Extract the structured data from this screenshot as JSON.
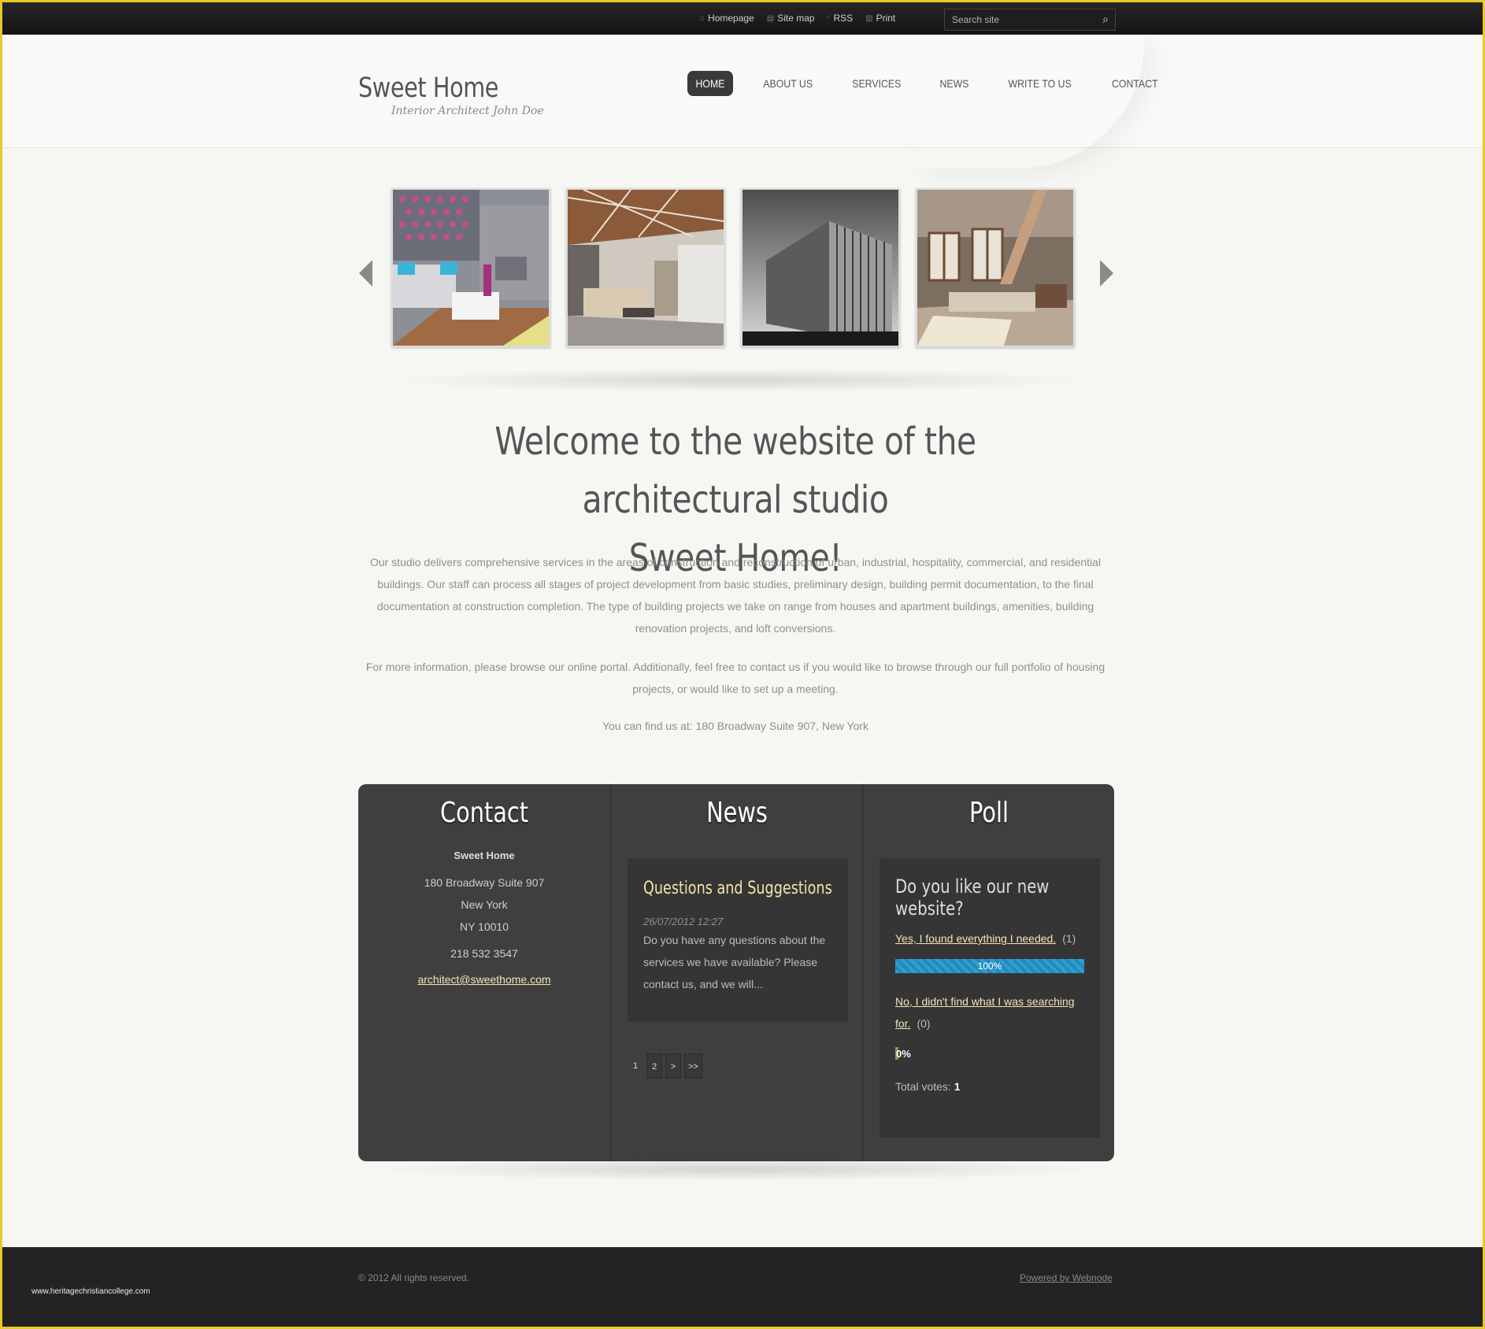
{
  "topbar": {
    "links": [
      {
        "label": "Homepage",
        "icon": "home-icon"
      },
      {
        "label": "Site map",
        "icon": "sitemap-icon"
      },
      {
        "label": "RSS",
        "icon": "rss-icon"
      },
      {
        "label": "Print",
        "icon": "print-icon"
      }
    ],
    "search_placeholder": "Search site"
  },
  "header": {
    "logo": "Sweet Home",
    "tagline": "Interior Architect John Doe",
    "nav": [
      "HOME",
      "ABOUT US",
      "SERVICES",
      "NEWS",
      "WRITE TO US",
      "CONTACT"
    ],
    "active_nav": "HOME"
  },
  "gallery": {
    "items": [
      "interior-living-room-1",
      "interior-living-room-2",
      "office-building",
      "interior-living-room-3"
    ]
  },
  "welcome": {
    "title_line1": "Welcome to the website of the architectural studio",
    "title_line2": "Sweet Home!",
    "p1": "Our studio delivers comprehensive services in the areas of construction and reconstruction of urban, industrial, hospitality, commercial, and residential buildings. Our staff can process all stages of project development from basic studies, preliminary design, building permit documentation, to the final documentation at construction completion. The type of building projects we take on range from houses and apartment buildings, amenities, building renovation projects, and loft conversions.",
    "p2": "For more information, please browse our online portal. Additionally, feel free to contact us if you would like to browse through our full portfolio of housing projects, or would like to set up a meeting.",
    "p3": "You can find us at: 180 Broadway Suite 907, New York"
  },
  "contact": {
    "title": "Contact",
    "name": "Sweet Home",
    "address1": "180 Broadway Suite 907",
    "address2": "New York",
    "address3": "NY 10010",
    "phone": "218 532 3547",
    "email": "architect@sweethome.com"
  },
  "news": {
    "title": "News",
    "item": {
      "title": "Questions and Suggestions",
      "date": "26/07/2012 12:27",
      "text": "Do you have any questions about the services we have available? Please contact us, and we will..."
    },
    "pager": [
      "1",
      "2",
      ">",
      ">>"
    ]
  },
  "poll": {
    "title": "Poll",
    "question": "Do you like our new website?",
    "answers": [
      {
        "text": "Yes, I found everything I needed.",
        "count": "(1)",
        "percent_label": "100%",
        "fraction": 1.0
      },
      {
        "text": "No, I didn't find what I was searching for.",
        "count": "(0)",
        "percent_label": "0%",
        "fraction": 0.0
      }
    ],
    "total_label": "Total votes:",
    "total": "1"
  },
  "footer": {
    "copyright": "© 2012 All rights reserved.",
    "powered": "Powered by Webnode",
    "watermark": "www.heritagechristiancollege.com"
  }
}
